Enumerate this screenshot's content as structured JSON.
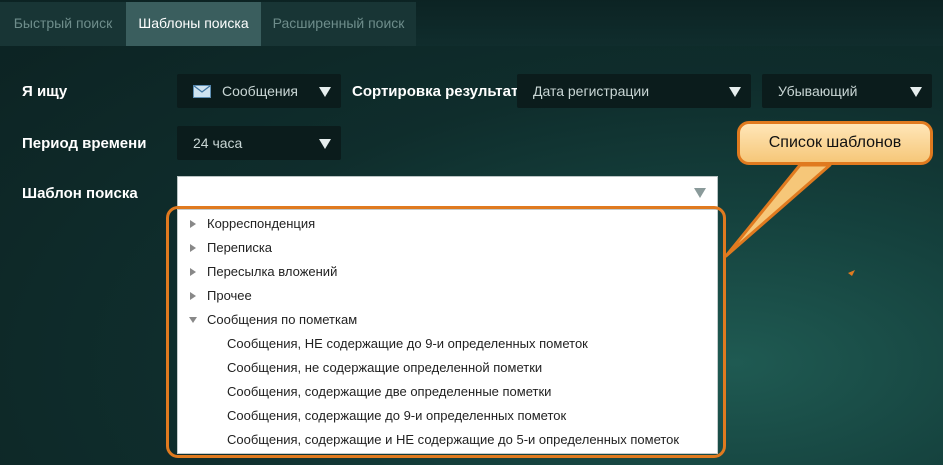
{
  "tabs": [
    {
      "label": "Быстрый поиск",
      "active": false
    },
    {
      "label": "Шаблоны поиска",
      "active": true
    },
    {
      "label": "Расширенный поиск",
      "active": false
    }
  ],
  "form": {
    "looking_for_label": "Я ищу",
    "looking_for_value": "Сообщения",
    "sort_label": "Сортировка результата",
    "sort_field_value": "Дата регистрации",
    "sort_order_value": "Убывающий",
    "period_label": "Период времени",
    "period_value": "24 часа",
    "template_label": "Шаблон поиска",
    "template_value": ""
  },
  "template_tree": {
    "groups": [
      {
        "label": "Корреспонденция",
        "expanded": false
      },
      {
        "label": "Переписка",
        "expanded": false
      },
      {
        "label": "Пересылка вложений",
        "expanded": false
      },
      {
        "label": "Прочее",
        "expanded": false
      },
      {
        "label": "Сообщения по пометкам",
        "expanded": true
      }
    ],
    "children": [
      "Сообщения, НЕ содержащие до 9-и определенных пометок",
      "Сообщения, не содержащие определенной пометки",
      "Сообщения, содержащие две определенные пометки",
      "Сообщения, содержащие до 9-и определенных пометок",
      "Сообщения, содержащие и НЕ содержащие до 5-и определенных пометок"
    ]
  },
  "annotation": {
    "callout_text": "Список шаблонов",
    "color": "#e07a1f"
  },
  "icons": {
    "looking_for": "envelope-icon",
    "dropdown": "chevron-down-icon",
    "collapsed": "triangle-right-icon",
    "expanded": "triangle-down-icon"
  }
}
